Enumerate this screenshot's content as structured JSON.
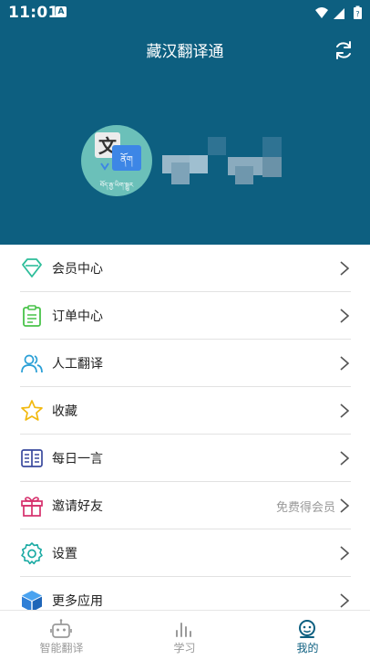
{
  "status_bar": {
    "time": "11:01",
    "notification_glyph": "A"
  },
  "header": {
    "title": "藏汉翻译通",
    "avatar_glyph_zh": "文",
    "avatar_glyph_bo": "ནོག",
    "avatar_caption": "བོད་རྒྱ་ཡིག་སྒྱུར"
  },
  "menu": {
    "items": [
      {
        "label": "会员中心",
        "icon": "diamond-icon"
      },
      {
        "label": "订单中心",
        "icon": "clipboard-icon"
      },
      {
        "label": "人工翻译",
        "icon": "people-icon"
      },
      {
        "label": "收藏",
        "icon": "star-icon"
      },
      {
        "label": "每日一言",
        "icon": "book-icon"
      },
      {
        "label": "邀请好友",
        "icon": "gift-icon",
        "extra": "免费得会员"
      },
      {
        "label": "设置",
        "icon": "gear-icon"
      },
      {
        "label": "更多应用",
        "icon": "cube-icon"
      }
    ]
  },
  "tabs": [
    {
      "label": "智能翻译",
      "icon": "robot-icon"
    },
    {
      "label": "学习",
      "icon": "bar-chart-icon"
    },
    {
      "label": "我的",
      "icon": "profile-icon",
      "active": true
    }
  ],
  "colors": {
    "header_bg": "#0d5f80",
    "accent": "#0d5f80"
  }
}
